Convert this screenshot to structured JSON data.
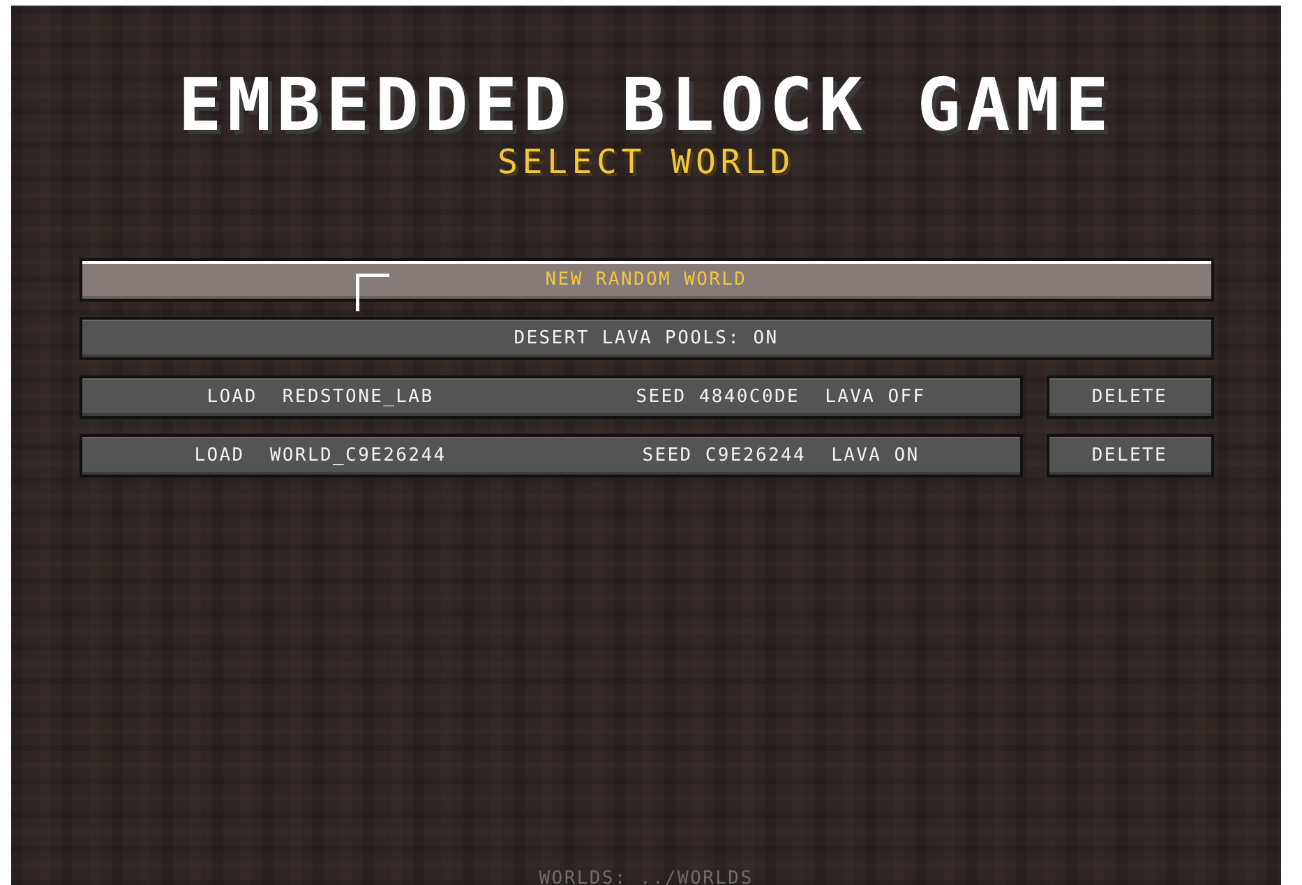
{
  "title": "EMBEDDED BLOCK GAME",
  "subtitle": "SELECT WORLD",
  "new_world_button": {
    "label": "NEW RANDOM WORLD",
    "hovered": true
  },
  "lava_toggle": {
    "label": "DESERT LAVA POOLS: ON"
  },
  "worlds": [
    {
      "load": "LOAD",
      "name": "REDSTONE_LAB",
      "seed": "SEED 4840C0DE",
      "lava": "LAVA OFF",
      "delete": "DELETE"
    },
    {
      "load": "LOAD",
      "name": "WORLD_C9E26244",
      "seed": "SEED C9E26244",
      "lava": "LAVA ON",
      "delete": "DELETE"
    }
  ],
  "footer": "WORLDS: ../WORLDS"
}
